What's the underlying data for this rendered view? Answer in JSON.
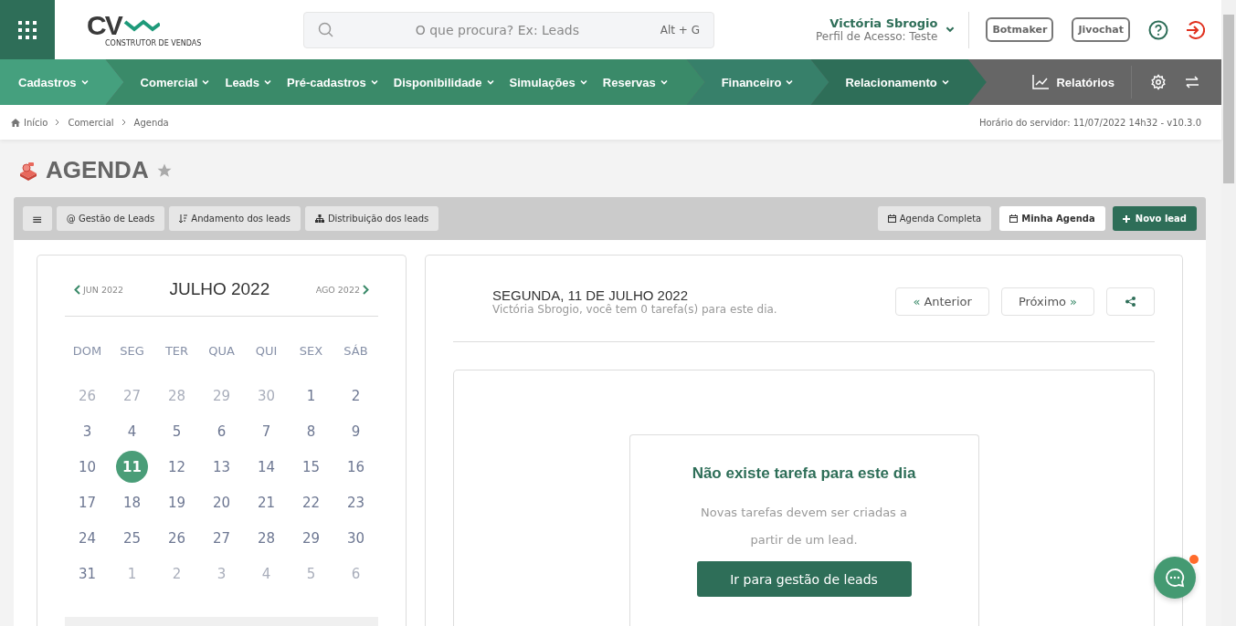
{
  "header": {
    "logo": {
      "mark": "CV",
      "tagline": "CONSTRUTOR DE VENDAS"
    },
    "search": {
      "placeholder": "O que procura? Ex: Leads",
      "shortcut": "Alt + G"
    },
    "user": {
      "name": "Victória Sbrogio",
      "profile": "Perfil de Acesso: Teste"
    },
    "buttons": [
      "Botmaker",
      "Jivochat"
    ]
  },
  "nav": {
    "segments": [
      {
        "color": "#45a07e",
        "items": [
          "Cadastros"
        ]
      },
      {
        "color": "#3a8a69",
        "items": [
          "Comercial",
          "Leads",
          "Pré-cadastros",
          "Disponibilidade",
          "Simulações",
          "Reservas"
        ]
      },
      {
        "color": "#37806a",
        "items": [
          "Financeiro"
        ]
      },
      {
        "color": "#2e6e58",
        "items": [
          "Relacionamento"
        ]
      }
    ],
    "reports": "Relatórios"
  },
  "breadcrumb": [
    "Início",
    "Comercial",
    "Agenda"
  ],
  "server_time": "Horário do servidor: 11/07/2022 14h32 - v10.3.0",
  "page": {
    "title": "AGENDA",
    "favorite": false
  },
  "toolbar": {
    "left": [
      {
        "kind": "menu",
        "label": "≡"
      },
      {
        "kind": "at",
        "label": "@ Gestão de Leads"
      },
      {
        "kind": "sort",
        "label": "Andamento dos leads"
      },
      {
        "kind": "tree",
        "label": "Distribuição dos leads"
      }
    ],
    "views": [
      {
        "label": "Agenda Completa",
        "selected": false
      },
      {
        "label": "Minha Agenda",
        "selected": true
      }
    ],
    "new_lead": "Novo lead"
  },
  "calendar": {
    "prev": "JUN 2022",
    "month": "JULHO 2022",
    "next": "AGO 2022",
    "weekdays": [
      "DOM",
      "SEG",
      "TER",
      "QUA",
      "QUI",
      "SEX",
      "SÁB"
    ],
    "weeks": [
      [
        {
          "day": "26",
          "muted": true,
          "selected": false
        },
        {
          "day": "27",
          "muted": true,
          "selected": false
        },
        {
          "day": "28",
          "muted": true,
          "selected": false
        },
        {
          "day": "29",
          "muted": true,
          "selected": false
        },
        {
          "day": "30",
          "muted": true,
          "selected": false
        },
        {
          "day": "1",
          "muted": false,
          "selected": false
        },
        {
          "day": "2",
          "muted": false,
          "selected": false
        }
      ],
      [
        {
          "day": "3",
          "muted": false,
          "selected": false
        },
        {
          "day": "4",
          "muted": false,
          "selected": false
        },
        {
          "day": "5",
          "muted": false,
          "selected": false
        },
        {
          "day": "6",
          "muted": false,
          "selected": false
        },
        {
          "day": "7",
          "muted": false,
          "selected": false
        },
        {
          "day": "8",
          "muted": false,
          "selected": false
        },
        {
          "day": "9",
          "muted": false,
          "selected": false
        }
      ],
      [
        {
          "day": "10",
          "muted": false,
          "selected": false
        },
        {
          "day": "11",
          "muted": false,
          "selected": true
        },
        {
          "day": "12",
          "muted": false,
          "selected": false
        },
        {
          "day": "13",
          "muted": false,
          "selected": false
        },
        {
          "day": "14",
          "muted": false,
          "selected": false
        },
        {
          "day": "15",
          "muted": false,
          "selected": false
        },
        {
          "day": "16",
          "muted": false,
          "selected": false
        }
      ],
      [
        {
          "day": "17",
          "muted": false,
          "selected": false
        },
        {
          "day": "18",
          "muted": false,
          "selected": false
        },
        {
          "day": "19",
          "muted": false,
          "selected": false
        },
        {
          "day": "20",
          "muted": false,
          "selected": false
        },
        {
          "day": "21",
          "muted": false,
          "selected": false
        },
        {
          "day": "22",
          "muted": false,
          "selected": false
        },
        {
          "day": "23",
          "muted": false,
          "selected": false
        }
      ],
      [
        {
          "day": "24",
          "muted": false,
          "selected": false
        },
        {
          "day": "25",
          "muted": false,
          "selected": false
        },
        {
          "day": "26",
          "muted": false,
          "selected": false
        },
        {
          "day": "27",
          "muted": false,
          "selected": false
        },
        {
          "day": "28",
          "muted": false,
          "selected": false
        },
        {
          "day": "29",
          "muted": false,
          "selected": false
        },
        {
          "day": "30",
          "muted": false,
          "selected": false
        }
      ],
      [
        {
          "day": "31",
          "muted": false,
          "selected": false
        },
        {
          "day": "1",
          "muted": true,
          "selected": false
        },
        {
          "day": "2",
          "muted": true,
          "selected": false
        },
        {
          "day": "3",
          "muted": true,
          "selected": false
        },
        {
          "day": "4",
          "muted": true,
          "selected": false
        },
        {
          "day": "5",
          "muted": true,
          "selected": false
        },
        {
          "day": "6",
          "muted": true,
          "selected": false
        }
      ]
    ]
  },
  "day": {
    "title": "SEGUNDA, 11 DE JULHO 2022",
    "subtitle": "Victória Sbrogio, você tem 0 tarefa(s) para este dia.",
    "prev": "Anterior",
    "prev_mark": "«",
    "next": "Próximo",
    "next_mark": "»",
    "empty": {
      "title": "Não existe tarefa para este dia",
      "text": "Novas tarefas devem ser criadas a partir de um lead.",
      "button": "Ir para gestão de leads"
    }
  },
  "chat": {
    "unread": true
  }
}
